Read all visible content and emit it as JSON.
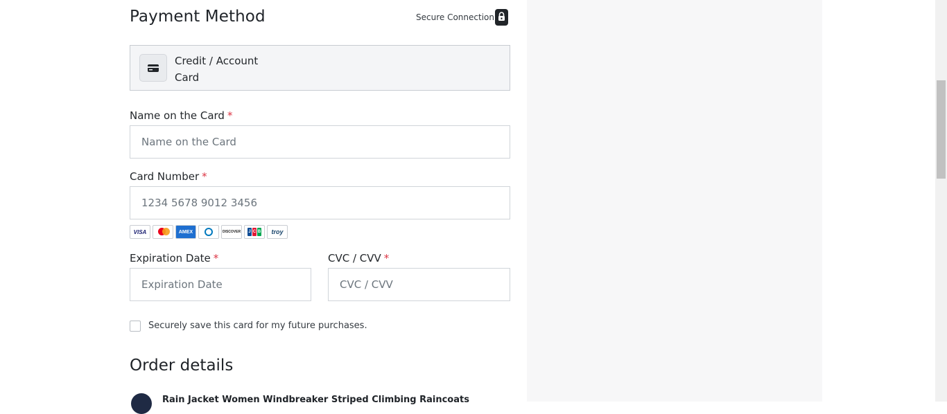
{
  "payment": {
    "title": "Payment Method",
    "secure_text": "Secure Connection",
    "method_label": "Credit / Account Card"
  },
  "form": {
    "name": {
      "label": "Name on the Card",
      "placeholder": "Name on the Card"
    },
    "number": {
      "label": "Card Number",
      "placeholder": "1234 5678 9012 3456"
    },
    "expiry": {
      "label": "Expiration Date",
      "placeholder": "Expiration Date"
    },
    "cvc": {
      "label": "CVC / CVV",
      "placeholder": "CVC / CVV"
    },
    "required_mark": "*",
    "save_card_label": "Securely save this card for my future purchases."
  },
  "brands": {
    "visa": "VISA",
    "amex": "AMEX",
    "discover": "DISCOVER",
    "troy": "troy",
    "jcb": [
      "J",
      "C",
      "B"
    ]
  },
  "order": {
    "title": "Order details",
    "product_title": "Rain Jacket Women Windbreaker Striped Climbing Raincoats"
  },
  "colors": {
    "required": "#dc3545",
    "right_panel_bg": "#f7f7f8"
  }
}
